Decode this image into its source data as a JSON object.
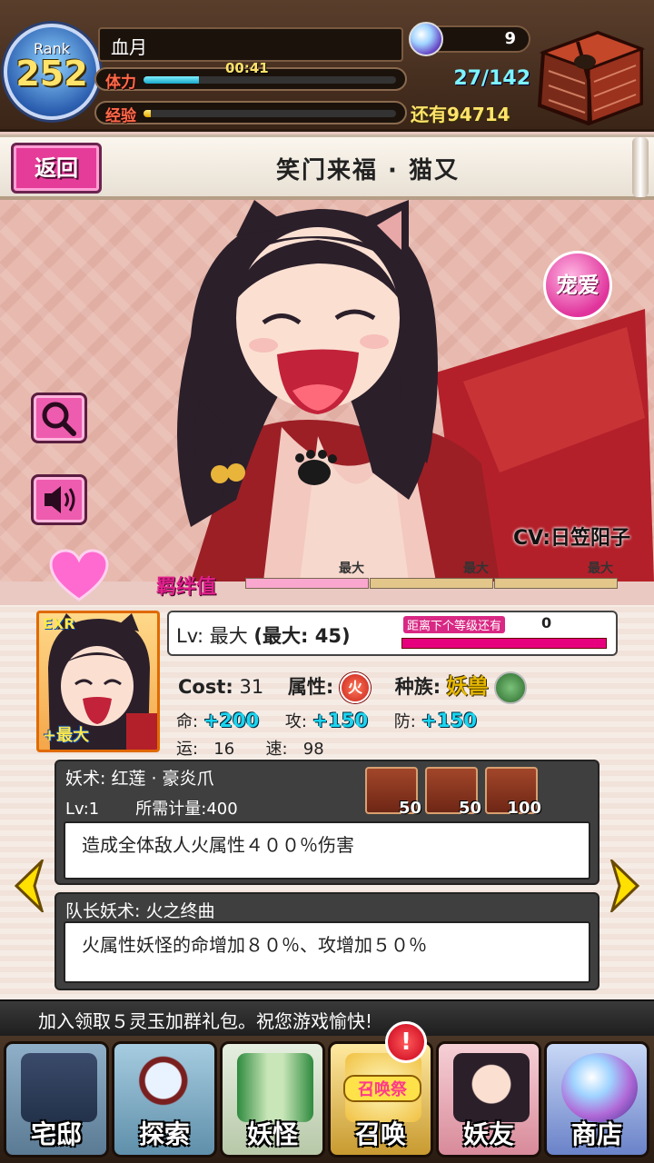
{
  "header": {
    "rank_label": "Rank",
    "rank_value": "252",
    "player_name": "血月",
    "stamina_label": "体力",
    "stamina_timer": "00:41",
    "stamina_fraction": 0.22,
    "exp_label": "经验",
    "exp_fraction": 0.03,
    "orb_count": "9",
    "box_count": "27/142",
    "remaining_exp": "还有94714"
  },
  "title_bar": {
    "back_label": "返回",
    "title": "笑门来福 · 猫又"
  },
  "art": {
    "favor_label": "宠爱",
    "cv_text": "CV:日笠阳子"
  },
  "bond": {
    "label": "羁绊值",
    "segments": [
      "最大",
      "最大",
      "最大"
    ]
  },
  "card": {
    "rarity_tag": "EXR",
    "plus_label": "+最大"
  },
  "level": {
    "lv_label": "Lv: 最大",
    "max_label": "(最大: 45)",
    "next_label": "距离下个等级还有",
    "next_value": "0"
  },
  "profile": {
    "cost_label": "Cost:",
    "cost_value": "31",
    "attr_label": "属性:",
    "attr_icon": "火",
    "race_label": "种族:",
    "race_value": "妖兽"
  },
  "stats": {
    "hp_label": "命:",
    "hp_value": "+200",
    "atk_label": "攻:",
    "atk_value": "+150",
    "def_label": "防:",
    "def_value": "+150",
    "luck_label": "运:",
    "luck_value": "16",
    "spd_label": "速:",
    "spd_value": "98"
  },
  "skill": {
    "title": "妖术: 红莲 · 豪炎爪",
    "level": "Lv:1",
    "gauge_label": "所需计量:400",
    "gauges": [
      "50",
      "50",
      "100"
    ],
    "description": "造成全体敌人火属性４００％伤害"
  },
  "leader_skill": {
    "title": "队长妖术: 火之终曲",
    "description": "火属性妖怪的命增加８０％、攻增加５０％"
  },
  "marquee": "加入领取５灵玉加群礼包。祝您游戏愉快!",
  "nav": {
    "items": [
      "宅邸",
      "探索",
      "妖怪",
      "召唤",
      "妖友",
      "商店"
    ],
    "summon_tag": "召唤祭",
    "summon_badge": "!"
  },
  "colors": {
    "accent_pink": "#e53c9a",
    "stamina": "#18a8c8",
    "exp": "#e6a800",
    "stat_value": "#1bd5f0"
  }
}
